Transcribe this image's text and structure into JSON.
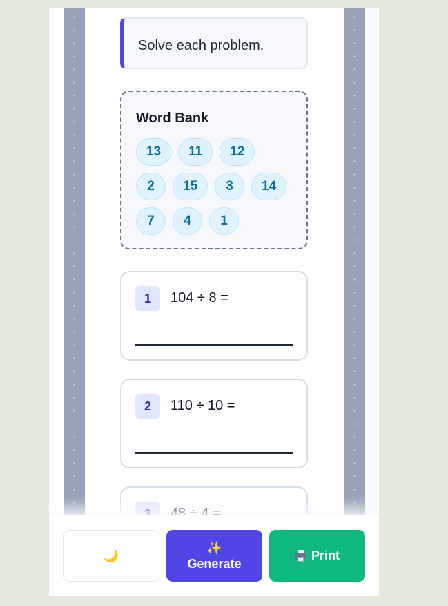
{
  "instructions": "Solve each problem.",
  "word_bank": {
    "title": "Word Bank",
    "rows": [
      [
        "13",
        "11",
        "12"
      ],
      [
        "2",
        "15",
        "3",
        "14"
      ],
      [
        "7",
        "4",
        "1"
      ]
    ]
  },
  "problems": [
    {
      "number": "1",
      "expression": "104 ÷ 8 ="
    },
    {
      "number": "2",
      "expression": "110 ÷ 10 ="
    },
    {
      "number": "3",
      "expression": "48 ÷ 4 ="
    }
  ],
  "toolbar": {
    "theme_icon": "moon-icon",
    "theme_glyph": "🌙",
    "generate_icon": "sparkles-icon",
    "generate_glyph": "✨",
    "generate_label": "Generate",
    "print_icon": "printer-icon",
    "print_label": "Print"
  },
  "colors": {
    "accent": "#4f46e5",
    "print": "#10b981",
    "chip_bg": "#e0f2fe",
    "chip_text": "#0a6f99",
    "page_bg": "#e3eadb",
    "rail": "#97a2b7"
  }
}
